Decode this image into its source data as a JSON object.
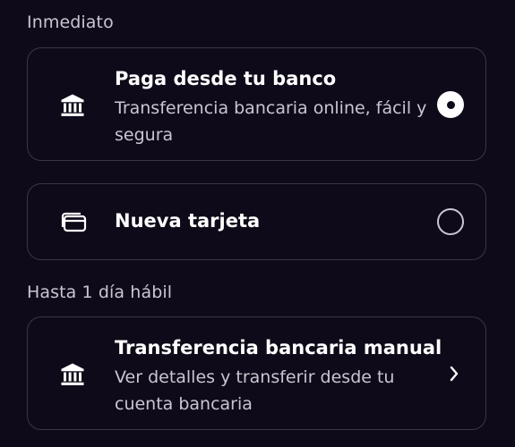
{
  "sections": [
    {
      "label": "Inmediato",
      "options": [
        {
          "title": "Paga desde tu banco",
          "subtitle": "Transferencia bancaria online, fácil y segura",
          "icon": "bank-icon",
          "control": "radio",
          "selected": true
        },
        {
          "title": "Nueva tarjeta",
          "icon": "credit-card-icon",
          "control": "radio",
          "selected": false
        }
      ]
    },
    {
      "label": "Hasta 1 día hábil",
      "options": [
        {
          "title": "Transferencia bancaria manual",
          "subtitle": "Ver detalles y transferir desde tu cuenta bancaria",
          "icon": "bank-icon",
          "control": "chevron-right-icon"
        }
      ]
    }
  ],
  "colors": {
    "background": "#0f0a19",
    "border": "#3b3645",
    "text_primary": "#ffffff",
    "text_secondary": "#c9c6d0"
  }
}
